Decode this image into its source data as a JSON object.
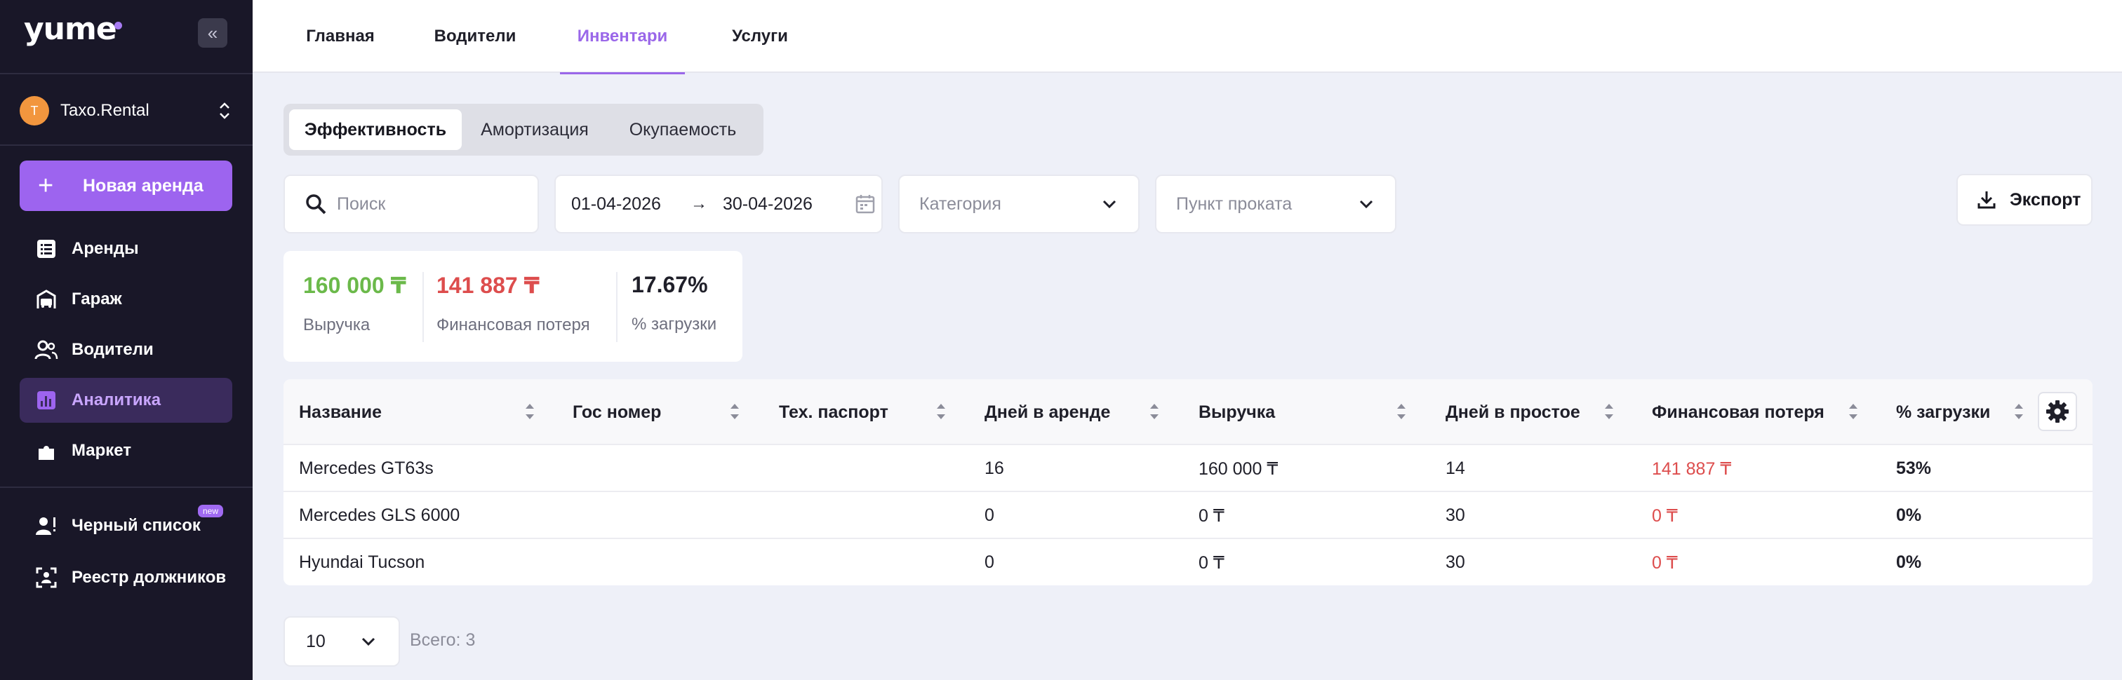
{
  "brand": {
    "logo": "yume"
  },
  "org": {
    "avatar_letter": "T",
    "name": "Taxo.Rental"
  },
  "sidebar": {
    "new_rental_label": "Новая аренда",
    "items": [
      {
        "label": "Аренды",
        "icon": "list-icon"
      },
      {
        "label": "Гараж",
        "icon": "car-icon"
      },
      {
        "label": "Водители",
        "icon": "users-icon"
      },
      {
        "label": "Аналитика",
        "icon": "chart-icon",
        "active": true
      },
      {
        "label": "Маркет",
        "icon": "puzzle-icon"
      },
      {
        "label": "Черный список",
        "icon": "user-alert-icon",
        "badge": "new"
      },
      {
        "label": "Реестр должников",
        "icon": "user-scan-icon"
      }
    ]
  },
  "top_tabs": [
    {
      "label": "Главная"
    },
    {
      "label": "Водители"
    },
    {
      "label": "Инвентари",
      "active": true
    },
    {
      "label": "Услуги"
    }
  ],
  "segments": [
    {
      "label": "Эффективность",
      "active": true
    },
    {
      "label": "Амортизация"
    },
    {
      "label": "Окупаемость"
    }
  ],
  "filters": {
    "search_placeholder": "Поиск",
    "date_from": "01-04-2026",
    "date_to": "30-04-2026",
    "category_placeholder": "Категория",
    "point_placeholder": "Пункт проката",
    "export_label": "Экспорт"
  },
  "summary": {
    "revenue": {
      "value": "160 000 ₸",
      "label": "Выручка",
      "color": "#6bb94a"
    },
    "loss": {
      "value": "141 887 ₸",
      "label": "Финансовая потеря",
      "color": "#dd4d4d"
    },
    "load": {
      "value": "17.67%",
      "label": "% загрузки"
    }
  },
  "table": {
    "columns": [
      "Название",
      "Гос номер",
      "Тех. паспорт",
      "Дней в аренде",
      "Выручка",
      "Дней в простое",
      "Финансовая потеря",
      "% загрузки"
    ],
    "rows": [
      [
        "Mercedes GT63s",
        "",
        "",
        "16",
        "160 000 ₸",
        "14",
        "141 887 ₸",
        "53%"
      ],
      [
        "Mercedes GLS 6000",
        "",
        "",
        "0",
        "0 ₸",
        "30",
        "0 ₸",
        "0%"
      ],
      [
        "Hyundai Tucson",
        "",
        "",
        "0",
        "0 ₸",
        "30",
        "0 ₸",
        "0%"
      ]
    ]
  },
  "pagination": {
    "page_size": "10",
    "total": "Всего: 3"
  },
  "colors": {
    "accent": "#9d64ef",
    "sidebar_bg": "#191728",
    "danger": "#dd4d4d",
    "success": "#6bb94a"
  }
}
